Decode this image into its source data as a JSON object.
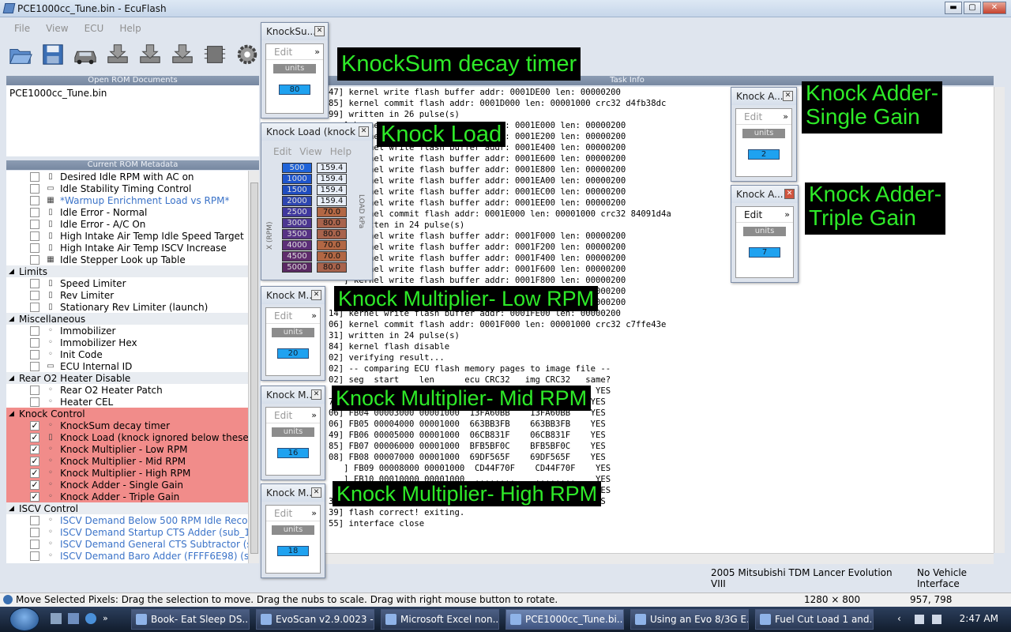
{
  "window": {
    "title": "PCE1000cc_Tune.bin - EcuFlash"
  },
  "menu": [
    "File",
    "View",
    "ECU",
    "Help"
  ],
  "toolbar_icons": [
    "open-folder-icon",
    "save-icon",
    "car-icon",
    "download-icon",
    "upload-icon",
    "test-write-icon",
    "chip-icon",
    "gear-icon"
  ],
  "panels": {
    "open_rom": "Open ROM Documents",
    "task_info": "Task Info",
    "metadata": "Current ROM Metadata"
  },
  "open_docs": [
    "PCE1000cc_Tune.bin"
  ],
  "tree": [
    {
      "type": "item",
      "icon": "1d",
      "label": "Desired Idle RPM with AC on"
    },
    {
      "type": "item",
      "icon": "2d",
      "label": "Idle Stability Timing Control"
    },
    {
      "type": "item",
      "icon": "3d",
      "label": "*Warmup Enrichment Load vs RPM*",
      "blue": true
    },
    {
      "type": "item",
      "icon": "1d",
      "label": "Idle Error - Normal"
    },
    {
      "type": "item",
      "icon": "1d",
      "label": "Idle Error - A/C On"
    },
    {
      "type": "item",
      "icon": "1d",
      "label": "High Intake Air Temp Idle Speed Target"
    },
    {
      "type": "item",
      "icon": "1d",
      "label": "High Intake Air Temp ISCV Increase"
    },
    {
      "type": "item",
      "icon": "3d",
      "label": "Idle Stepper Look up Table"
    },
    {
      "type": "group",
      "label": "Limits"
    },
    {
      "type": "item",
      "icon": "1d",
      "label": "Speed Limiter"
    },
    {
      "type": "item",
      "icon": "1d",
      "label": "Rev Limiter"
    },
    {
      "type": "item",
      "icon": "1d",
      "label": "Stationary Rev Limiter (launch)"
    },
    {
      "type": "group",
      "label": "Miscellaneous"
    },
    {
      "type": "item",
      "icon": "0d",
      "label": "Immobilizer"
    },
    {
      "type": "item",
      "icon": "0d",
      "label": "Immobilizer Hex"
    },
    {
      "type": "item",
      "icon": "0d",
      "label": "Init Code"
    },
    {
      "type": "item",
      "icon": "2d",
      "label": "ECU Internal ID"
    },
    {
      "type": "group",
      "label": "Rear O2 Heater Disable"
    },
    {
      "type": "item",
      "icon": "0d",
      "label": "Rear O2 Heater Patch"
    },
    {
      "type": "item",
      "icon": "0d",
      "label": "Heater CEL"
    },
    {
      "type": "group",
      "label": "Knock Control",
      "hl": true
    },
    {
      "type": "item",
      "icon": "0d",
      "label": "KnockSum decay timer",
      "checked": true,
      "hl": true
    },
    {
      "type": "item",
      "icon": "1d",
      "label": "Knock Load (knock ignored below these va...",
      "checked": true,
      "hl": true
    },
    {
      "type": "item",
      "icon": "0d",
      "label": "Knock Multiplier - Low RPM",
      "checked": true,
      "hl": true
    },
    {
      "type": "item",
      "icon": "0d",
      "label": "Knock Multiplier - Mid RPM",
      "checked": true,
      "hl": true
    },
    {
      "type": "item",
      "icon": "0d",
      "label": "Knock Multiplier - High RPM",
      "checked": true,
      "hl": true
    },
    {
      "type": "item",
      "icon": "0d",
      "label": "Knock Adder - Single Gain",
      "checked": true,
      "hl": true
    },
    {
      "type": "item",
      "icon": "0d",
      "label": "Knock Adder - Triple Gain",
      "checked": true,
      "hl": true
    },
    {
      "type": "group",
      "label": "ISCV Control"
    },
    {
      "type": "item",
      "icon": "0d",
      "label": "ISCV Demand Below 500 RPM Idle Recover...",
      "blue": true
    },
    {
      "type": "item",
      "icon": "0d",
      "label": "ISCV Demand Startup CTS Adder (sub_1EB...",
      "blue": true
    },
    {
      "type": "item",
      "icon": "0d",
      "label": "ISCV Demand General CTS Subtractor (sub...",
      "blue": true
    },
    {
      "type": "item",
      "icon": "0d",
      "label": "ISCV Demand Baro Adder (FFFF6E98) (sub_...",
      "blue": true
    }
  ],
  "log": [
    "47] kernel write flash buffer addr: 0001DE00 len: 00000200",
    "85] kernel commit flash addr: 0001D000 len: 00001000 crc32 d4fb38dc",
    "99] written in 26 pulse(s)",
    "   ] kernel write flash buffer addr: 0001E000 len: 00000200",
    "   ] kernel write flash buffer addr: 0001E200 len: 00000200",
    "   ] kernel write flash buffer addr: 0001E400 len: 00000200",
    "   ] kernel write flash buffer addr: 0001E600 len: 00000200",
    "   ] kernel write flash buffer addr: 0001E800 len: 00000200",
    "   ] kernel write flash buffer addr: 0001EA00 len: 00000200",
    "   ] kernel write flash buffer addr: 0001EC00 len: 00000200",
    "   ] kernel write flash buffer addr: 0001EE00 len: 00000200",
    "   ] kernel commit flash addr: 0001E000 len: 00001000 crc32 84091d4a",
    "   ] written in 24 pulse(s)",
    "   ] kernel write flash buffer addr: 0001F000 len: 00000200",
    "   ] kernel write flash buffer addr: 0001F200 len: 00000200",
    "   ] kernel write flash buffer addr: 0001F400 len: 00000200",
    "   ] kernel write flash buffer addr: 0001F600 len: 00000200",
    "   ] kernel write flash buffer addr: 0001F800 len: 00000200",
    "   ] kernel write flash buffer addr: 0001FA00 len: 00000200",
    "   ] kernel write flash buffer addr: 0001FC00 len: 00000200",
    "14] kernel write flash buffer addr: 0001FE00 len: 00000200",
    "06] kernel commit flash addr: 0001F000 len: 00001000 crc32 c7ffe43e",
    "31] written in 24 pulse(s)",
    "84] kernel flash disable",
    "02] verifying result...",
    "02] -- comparing ECU flash memory pages to image file --",
    "02] seg  start    len      ecu CRC32   img CRC32   same?",
    "   ] FB02 00001000 00001000  ........    ........    YES",
    "78] FB03 00002000 00001000  621A93A2    621A93A2    YES",
    "06] FB04 00003000 00001000  13FA60BB    13FA60BB    YES",
    "06] FB05 00004000 00001000  663BB3FB    663BB3FB    YES",
    "49] FB06 00005000 00001000  06CB831F    06CB831F    YES",
    "85] FB07 00006000 00001000  BFB5BF0C    BFB5BF0C    YES",
    "08] FB08 00007000 00001000  69DF565F    69DF565F    YES",
    "   ] FB09 00008000 00001000  CD44F70F    CD44F70F    YES",
    "   ] FB10 00010000 00001000  ........    ........    YES",
    "   ] FB11 00020000 00001000  ........    ........    YES",
    "39] FB12 00030000 00001000  D69B51CD    D69B51CD    YES",
    "39] flash correct! exiting.",
    "55] interface close"
  ],
  "vehicle_status": "2005 Mitsubishi TDM Lancer Evolution VIII",
  "interface_status": "No Vehicle Interface",
  "subwindows": {
    "knocksum": {
      "title": "KnockSu...",
      "menu": "Edit",
      "units": "units",
      "value": "80"
    },
    "knockload": {
      "title": "Knock Load (knock ...",
      "menu": [
        "Edit",
        "View",
        "Help"
      ],
      "xlabel": "X (RPM)",
      "ylabel": "LOAD kPa",
      "rows": [
        [
          "500",
          "159.4"
        ],
        [
          "1000",
          "159.4"
        ],
        [
          "1500",
          "159.4"
        ],
        [
          "2000",
          "159.4"
        ],
        [
          "2500",
          "70.0"
        ],
        [
          "3000",
          "80.0"
        ],
        [
          "3500",
          "80.0"
        ],
        [
          "4000",
          "70.0"
        ],
        [
          "4500",
          "70.0"
        ],
        [
          "5000",
          "80.0"
        ]
      ]
    },
    "mult_low": {
      "title": "Knock M...",
      "menu": "Edit",
      "units": "units",
      "value": "20"
    },
    "mult_mid": {
      "title": "Knock M...",
      "menu": "Edit",
      "units": "units",
      "value": "16"
    },
    "mult_high": {
      "title": "Knock M...",
      "menu": "Edit",
      "units": "units",
      "value": "18"
    },
    "adder_single": {
      "title": "Knock A...",
      "menu": "Edit",
      "units": "units",
      "value": "2"
    },
    "adder_triple": {
      "title": "Knock A...",
      "menu": "Edit",
      "units": "units",
      "value": "7"
    }
  },
  "captions": {
    "knocksum": "KnockSum decay timer",
    "knockload": "Knock Load",
    "mult_low": "Knock Multiplier- Low RPM",
    "mult_mid": "Knock Multiplier- Mid RPM",
    "mult_high": "Knock Multiplier- High RPM",
    "adder_single": "Knock Adder-\nSingle Gain",
    "adder_triple": "Knock Adder-\nTriple Gain"
  },
  "paint_status": {
    "hint": "Move Selected Pixels: Drag the selection to move. Drag the nubs to scale. Drag with right mouse button to rotate.",
    "size": "1280 × 800",
    "pos": "957, 798"
  },
  "taskbar": {
    "items": [
      "Book- Eat Sleep DS...",
      "EvoScan v2.9.0023 - ...",
      "Microsoft Excel non...",
      "PCE1000cc_Tune.bi...",
      "Using an Evo 8/3G E...",
      "Fuel Cut Load 1 and..."
    ],
    "clock": "2:47 AM"
  }
}
